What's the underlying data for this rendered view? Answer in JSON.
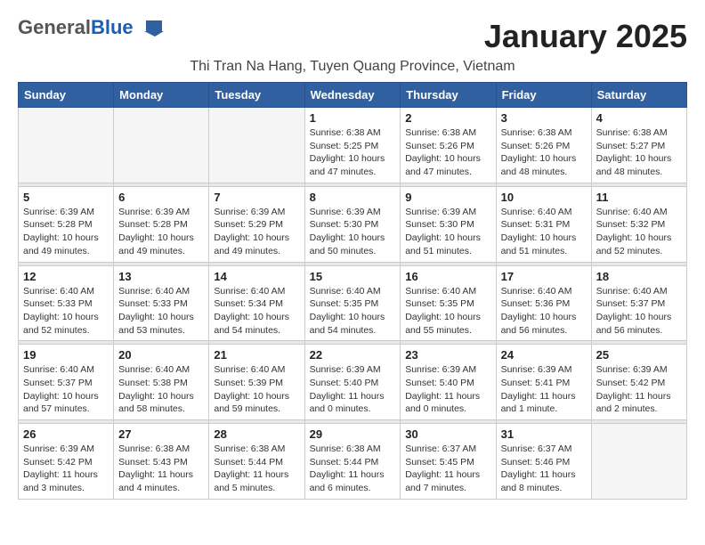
{
  "header": {
    "logo_general": "General",
    "logo_blue": "Blue",
    "title": "January 2025",
    "subtitle": "Thi Tran Na Hang, Tuyen Quang Province, Vietnam"
  },
  "days_of_week": [
    "Sunday",
    "Monday",
    "Tuesday",
    "Wednesday",
    "Thursday",
    "Friday",
    "Saturday"
  ],
  "weeks": [
    {
      "days": [
        {
          "num": "",
          "info": ""
        },
        {
          "num": "",
          "info": ""
        },
        {
          "num": "",
          "info": ""
        },
        {
          "num": "1",
          "info": "Sunrise: 6:38 AM\nSunset: 5:25 PM\nDaylight: 10 hours\nand 47 minutes."
        },
        {
          "num": "2",
          "info": "Sunrise: 6:38 AM\nSunset: 5:26 PM\nDaylight: 10 hours\nand 47 minutes."
        },
        {
          "num": "3",
          "info": "Sunrise: 6:38 AM\nSunset: 5:26 PM\nDaylight: 10 hours\nand 48 minutes."
        },
        {
          "num": "4",
          "info": "Sunrise: 6:38 AM\nSunset: 5:27 PM\nDaylight: 10 hours\nand 48 minutes."
        }
      ]
    },
    {
      "days": [
        {
          "num": "5",
          "info": "Sunrise: 6:39 AM\nSunset: 5:28 PM\nDaylight: 10 hours\nand 49 minutes."
        },
        {
          "num": "6",
          "info": "Sunrise: 6:39 AM\nSunset: 5:28 PM\nDaylight: 10 hours\nand 49 minutes."
        },
        {
          "num": "7",
          "info": "Sunrise: 6:39 AM\nSunset: 5:29 PM\nDaylight: 10 hours\nand 49 minutes."
        },
        {
          "num": "8",
          "info": "Sunrise: 6:39 AM\nSunset: 5:30 PM\nDaylight: 10 hours\nand 50 minutes."
        },
        {
          "num": "9",
          "info": "Sunrise: 6:39 AM\nSunset: 5:30 PM\nDaylight: 10 hours\nand 51 minutes."
        },
        {
          "num": "10",
          "info": "Sunrise: 6:40 AM\nSunset: 5:31 PM\nDaylight: 10 hours\nand 51 minutes."
        },
        {
          "num": "11",
          "info": "Sunrise: 6:40 AM\nSunset: 5:32 PM\nDaylight: 10 hours\nand 52 minutes."
        }
      ]
    },
    {
      "days": [
        {
          "num": "12",
          "info": "Sunrise: 6:40 AM\nSunset: 5:33 PM\nDaylight: 10 hours\nand 52 minutes."
        },
        {
          "num": "13",
          "info": "Sunrise: 6:40 AM\nSunset: 5:33 PM\nDaylight: 10 hours\nand 53 minutes."
        },
        {
          "num": "14",
          "info": "Sunrise: 6:40 AM\nSunset: 5:34 PM\nDaylight: 10 hours\nand 54 minutes."
        },
        {
          "num": "15",
          "info": "Sunrise: 6:40 AM\nSunset: 5:35 PM\nDaylight: 10 hours\nand 54 minutes."
        },
        {
          "num": "16",
          "info": "Sunrise: 6:40 AM\nSunset: 5:35 PM\nDaylight: 10 hours\nand 55 minutes."
        },
        {
          "num": "17",
          "info": "Sunrise: 6:40 AM\nSunset: 5:36 PM\nDaylight: 10 hours\nand 56 minutes."
        },
        {
          "num": "18",
          "info": "Sunrise: 6:40 AM\nSunset: 5:37 PM\nDaylight: 10 hours\nand 56 minutes."
        }
      ]
    },
    {
      "days": [
        {
          "num": "19",
          "info": "Sunrise: 6:40 AM\nSunset: 5:37 PM\nDaylight: 10 hours\nand 57 minutes."
        },
        {
          "num": "20",
          "info": "Sunrise: 6:40 AM\nSunset: 5:38 PM\nDaylight: 10 hours\nand 58 minutes."
        },
        {
          "num": "21",
          "info": "Sunrise: 6:40 AM\nSunset: 5:39 PM\nDaylight: 10 hours\nand 59 minutes."
        },
        {
          "num": "22",
          "info": "Sunrise: 6:39 AM\nSunset: 5:40 PM\nDaylight: 11 hours\nand 0 minutes."
        },
        {
          "num": "23",
          "info": "Sunrise: 6:39 AM\nSunset: 5:40 PM\nDaylight: 11 hours\nand 0 minutes."
        },
        {
          "num": "24",
          "info": "Sunrise: 6:39 AM\nSunset: 5:41 PM\nDaylight: 11 hours\nand 1 minute."
        },
        {
          "num": "25",
          "info": "Sunrise: 6:39 AM\nSunset: 5:42 PM\nDaylight: 11 hours\nand 2 minutes."
        }
      ]
    },
    {
      "days": [
        {
          "num": "26",
          "info": "Sunrise: 6:39 AM\nSunset: 5:42 PM\nDaylight: 11 hours\nand 3 minutes."
        },
        {
          "num": "27",
          "info": "Sunrise: 6:38 AM\nSunset: 5:43 PM\nDaylight: 11 hours\nand 4 minutes."
        },
        {
          "num": "28",
          "info": "Sunrise: 6:38 AM\nSunset: 5:44 PM\nDaylight: 11 hours\nand 5 minutes."
        },
        {
          "num": "29",
          "info": "Sunrise: 6:38 AM\nSunset: 5:44 PM\nDaylight: 11 hours\nand 6 minutes."
        },
        {
          "num": "30",
          "info": "Sunrise: 6:37 AM\nSunset: 5:45 PM\nDaylight: 11 hours\nand 7 minutes."
        },
        {
          "num": "31",
          "info": "Sunrise: 6:37 AM\nSunset: 5:46 PM\nDaylight: 11 hours\nand 8 minutes."
        },
        {
          "num": "",
          "info": ""
        }
      ]
    }
  ]
}
